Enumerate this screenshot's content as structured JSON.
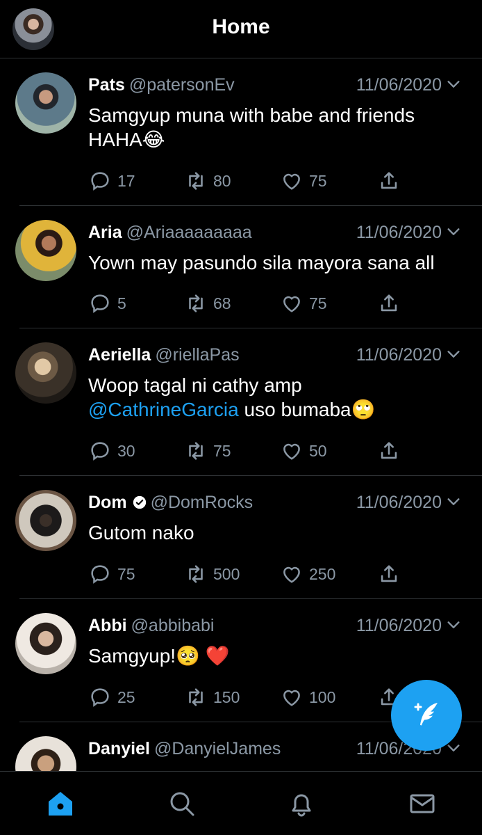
{
  "header": {
    "title": "Home"
  },
  "tweets": [
    {
      "name": "Pats",
      "handle": "@patersonEv",
      "date": "11/06/2020",
      "verified": false,
      "text_parts": [
        "Samgyup muna with babe and friends HAHA",
        "😂"
      ],
      "replies": "17",
      "retweets": "80",
      "likes": "75"
    },
    {
      "name": "Aria",
      "handle": "@Ariaaaaaaaaa",
      "date": "11/06/2020",
      "verified": false,
      "text_parts": [
        "Yown may pasundo sila mayora sana all"
      ],
      "replies": "5",
      "retweets": "68",
      "likes": "75"
    },
    {
      "name": "Aeriella",
      "handle": "@riellaPas",
      "date": "11/06/2020",
      "verified": false,
      "text_parts": [
        "Woop tagal ni cathy amp ",
        "@CathrineGarcia",
        " uso bumaba",
        "🙄"
      ],
      "replies": "30",
      "retweets": "75",
      "likes": "50"
    },
    {
      "name": "Dom",
      "handle": "@DomRocks",
      "date": "11/06/2020",
      "verified": true,
      "text_parts": [
        "Gutom nako"
      ],
      "replies": "75",
      "retweets": "500",
      "likes": "250"
    },
    {
      "name": "Abbi",
      "handle": "@abbibabi",
      "date": "11/06/2020",
      "verified": false,
      "text_parts": [
        "Samgyup!",
        "🥺 ❤️"
      ],
      "replies": "25",
      "retweets": "150",
      "likes": "100"
    },
    {
      "name": "Danyiel",
      "handle": "@DanyielJames",
      "date": "11/06/2020",
      "verified": false,
      "text_parts": [],
      "replies": "",
      "retweets": "",
      "likes": ""
    }
  ],
  "fab": {
    "icon": "compose-tweet-icon"
  },
  "tabs": [
    {
      "icon": "home-icon",
      "active": true
    },
    {
      "icon": "search-icon",
      "active": false
    },
    {
      "icon": "bell-icon",
      "active": false
    },
    {
      "icon": "mail-icon",
      "active": false
    }
  ],
  "colors": {
    "accent": "#1da1f2",
    "background": "#000000",
    "muted": "#8b98a5",
    "divider": "#2f3336",
    "heart": "#e0245e"
  }
}
